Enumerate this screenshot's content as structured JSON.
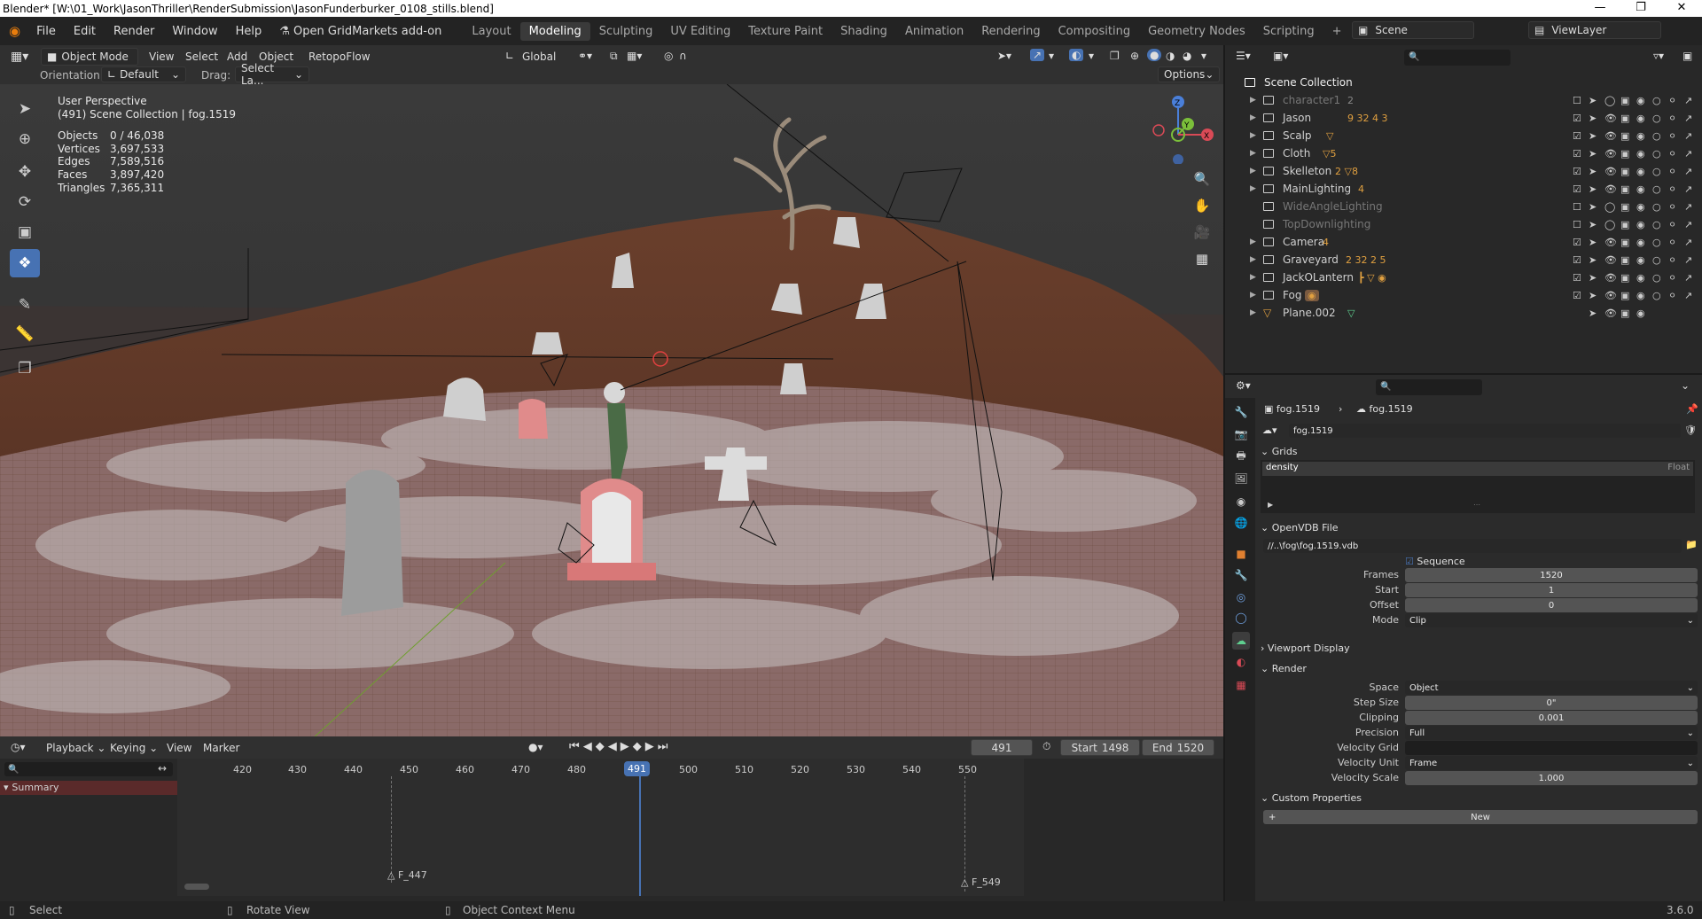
{
  "window": {
    "title": "Blender* [W:\\01_Work\\JasonThriller\\RenderSubmission\\JasonFunderburker_0108_stills.blend]"
  },
  "topbar": {
    "menus": [
      "File",
      "Edit",
      "Render",
      "Window",
      "Help"
    ],
    "addon_label": "Open GridMarkets add-on",
    "workspaces": [
      "Layout",
      "Modeling",
      "Sculpting",
      "UV Editing",
      "Texture Paint",
      "Shading",
      "Animation",
      "Rendering",
      "Compositing",
      "Geometry Nodes",
      "Scripting"
    ],
    "active_workspace": "Modeling",
    "scene": "Scene",
    "view_layer": "ViewLayer"
  },
  "viewport_header": {
    "mode": "Object Mode",
    "menus": [
      "View",
      "Select",
      "Add",
      "Object"
    ],
    "retopoflow": "RetopoFlow",
    "transform_orientation": "Global",
    "orientation_label": "Orientation:",
    "orientation_value": "Default",
    "drag_label": "Drag:",
    "drag_value": "Select La...",
    "options": "Options"
  },
  "viewport_overlay": {
    "perspective": "User Perspective",
    "collection_info": "(491) Scene Collection | fog.1519",
    "stats": [
      {
        "label": "Objects",
        "value": "0 / 46,038"
      },
      {
        "label": "Vertices",
        "value": "3,697,533"
      },
      {
        "label": "Edges",
        "value": "7,589,516"
      },
      {
        "label": "Faces",
        "value": "3,897,420"
      },
      {
        "label": "Triangles",
        "value": "7,365,311"
      }
    ],
    "gizmo_axes": [
      "Z",
      "Y",
      "X"
    ]
  },
  "timeline": {
    "menus": [
      "Playback",
      "Keying",
      "View",
      "Marker"
    ],
    "current_frame": "491",
    "start_label": "Start",
    "start": "1498",
    "end_label": "End",
    "end": "1520",
    "ruler": [
      "420",
      "430",
      "440",
      "450",
      "460",
      "470",
      "480",
      "491",
      "500",
      "510",
      "520",
      "530",
      "540",
      "550"
    ],
    "summary": "Summary",
    "markers": [
      "F_447",
      "F_549"
    ]
  },
  "outliner": {
    "root": "Scene Collection",
    "rows": [
      {
        "name": "character1",
        "sub": "2",
        "enabled": false
      },
      {
        "name": "Jason",
        "sub": "9 32 4 3",
        "enabled": true
      },
      {
        "name": "Scalp",
        "sub": "▽",
        "enabled": true
      },
      {
        "name": "Cloth",
        "sub": "▽5",
        "enabled": true
      },
      {
        "name": "Skelleton",
        "sub": "2 ▽8",
        "enabled": true
      },
      {
        "name": "MainLighting",
        "sub": "4",
        "enabled": true
      },
      {
        "name": "WideAngleLighting",
        "sub": "",
        "enabled": false
      },
      {
        "name": "TopDownlighting",
        "sub": "",
        "enabled": false
      },
      {
        "name": "Camera",
        "sub": "4",
        "enabled": true
      },
      {
        "name": "Graveyard",
        "sub": "2 32 2 5",
        "enabled": true
      },
      {
        "name": "JackOLantern",
        "sub": "",
        "enabled": true
      },
      {
        "name": "Fog",
        "sub": "",
        "enabled": true
      },
      {
        "name": "Plane.002",
        "sub": "",
        "enabled": true
      }
    ]
  },
  "properties": {
    "breadcrumb_object": "fog.1519",
    "breadcrumb_data": "fog.1519",
    "data_name": "fog.1519",
    "grids_panel": "Grids",
    "grid_name": "density",
    "grid_type": "Float",
    "openvdb_panel": "OpenVDB File",
    "file_path": "//..\\fog\\fog.1519.vdb",
    "sequence_label": "Sequence",
    "frames_label": "Frames",
    "frames": "1520",
    "start_label": "Start",
    "start": "1",
    "offset_label": "Offset",
    "offset": "0",
    "mode_label": "Mode",
    "mode": "Clip",
    "viewport_display_panel": "Viewport Display",
    "render_panel": "Render",
    "space_label": "Space",
    "space": "Object",
    "step_size_label": "Step Size",
    "step_size": "0\"",
    "clipping_label": "Clipping",
    "clipping": "0.001",
    "precision_label": "Precision",
    "precision": "Full",
    "velocity_grid_label": "Velocity Grid",
    "velocity_grid": "",
    "velocity_unit_label": "Velocity Unit",
    "velocity_unit": "Frame",
    "velocity_scale_label": "Velocity Scale",
    "velocity_scale": "1.000",
    "custom_props_panel": "Custom Properties",
    "new_button": "New"
  },
  "statusbar": {
    "select": "Select",
    "rotate": "Rotate View",
    "context": "Object Context Menu",
    "version": "3.6.0"
  }
}
